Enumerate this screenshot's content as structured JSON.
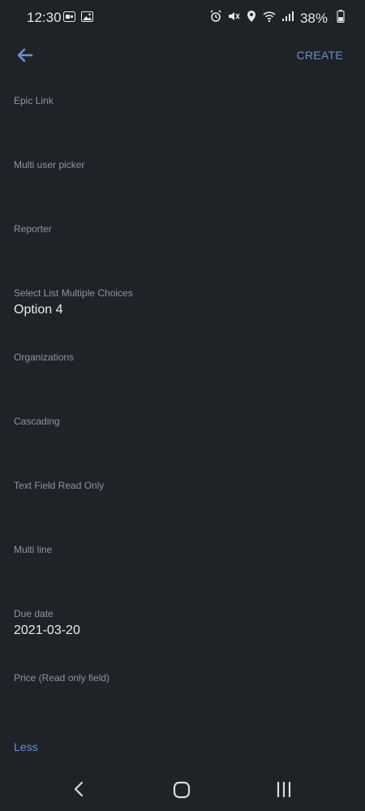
{
  "status_bar": {
    "time": "12:30",
    "battery": "38%"
  },
  "app_bar": {
    "action_label": "CREATE"
  },
  "fields": [
    {
      "label": "Epic Link",
      "value": ""
    },
    {
      "label": "Multi user picker",
      "value": ""
    },
    {
      "label": "Reporter",
      "value": ""
    },
    {
      "label": "Select List Multiple Choices",
      "value": "Option 4"
    },
    {
      "label": "Organizations",
      "value": ""
    },
    {
      "label": "Cascading",
      "value": ""
    },
    {
      "label": "Text Field Read Only",
      "value": ""
    },
    {
      "label": "Multi line",
      "value": ""
    },
    {
      "label": "Due date",
      "value": "2021-03-20"
    },
    {
      "label": "Price (Read only field)",
      "value": ""
    }
  ],
  "less_label": "Less",
  "colors": {
    "background": "#1f2227",
    "accent": "#6b8fd6",
    "label": "#8d96a3"
  }
}
